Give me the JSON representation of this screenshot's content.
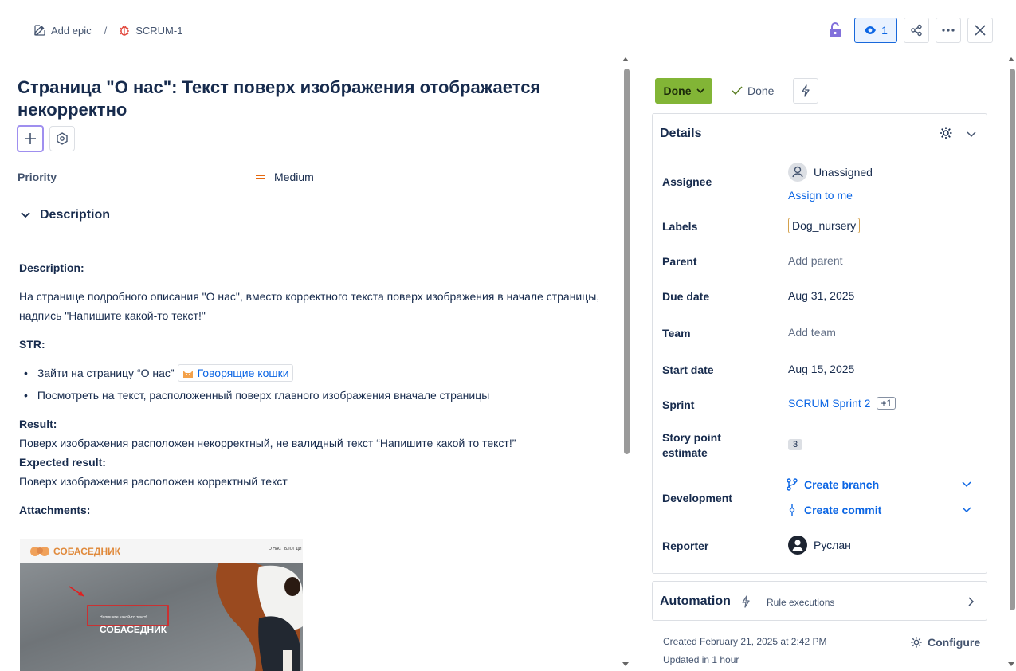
{
  "breadcrumb": {
    "add_epic": "Add epic",
    "separator": "/",
    "issue_key": "SCRUM-1"
  },
  "top_actions": {
    "watch_count": "1"
  },
  "issue": {
    "title": "Страница \"О нас\": Текст поверх изображения отображается некорректно",
    "priority_label": "Priority",
    "priority_value": "Medium",
    "description_heading": "Description"
  },
  "description": {
    "label": "Description:",
    "text": "На странице подробного описания \"О нас\", вместо корректного текста поверх изображения в начале страницы, надпись \"Напишите какой-то текст!\"",
    "str_label": "STR:",
    "str_items": [
      "Зайти на страницу “О нас”",
      "Посмотреть на текст, расположенный поверх главного изображения вначале страницы"
    ],
    "smartlink": "Говорящие кошки",
    "result_label": "Result:",
    "result_text": "Поверх изображения расположен некорректный, не валидный текст “Напишите какой то текст!”",
    "expected_label": "Expected result:",
    "expected_text": "Поверх изображения расположен корректный текст",
    "attachments_label": "Attachments:"
  },
  "attachment": {
    "logo": "СОБАСЕДНИК",
    "nav_1": "О НАС",
    "nav_2": "БЛОГ ДИ",
    "overlay_small": "Напишите какой-то текст!",
    "overlay_big": "СОБАСЕДНИК"
  },
  "status": {
    "button": "Done",
    "resolution": "Done"
  },
  "details": {
    "title": "Details",
    "assignee_label": "Assignee",
    "assignee_value": "Unassigned",
    "assign_to_me": "Assign to me",
    "labels_label": "Labels",
    "labels_value": "Dog_nursery",
    "parent_label": "Parent",
    "parent_value": "Add parent",
    "due_label": "Due date",
    "due_value": "Aug 31, 2025",
    "team_label": "Team",
    "team_value": "Add team",
    "start_label": "Start date",
    "start_value": "Aug 15, 2025",
    "sprint_label": "Sprint",
    "sprint_value": "SCRUM Sprint 2",
    "sprint_more": "+1",
    "story_label": "Story point estimate",
    "story_value": "3",
    "dev_label": "Development",
    "create_branch": "Create branch",
    "create_commit": "Create commit",
    "reporter_label": "Reporter",
    "reporter_value": "Руслан"
  },
  "automation": {
    "title": "Automation",
    "subtitle": "Rule executions"
  },
  "meta": {
    "created": "Created February 21, 2025 at 2:42 PM",
    "updated": "Updated in 1 hour",
    "configure": "Configure"
  }
}
